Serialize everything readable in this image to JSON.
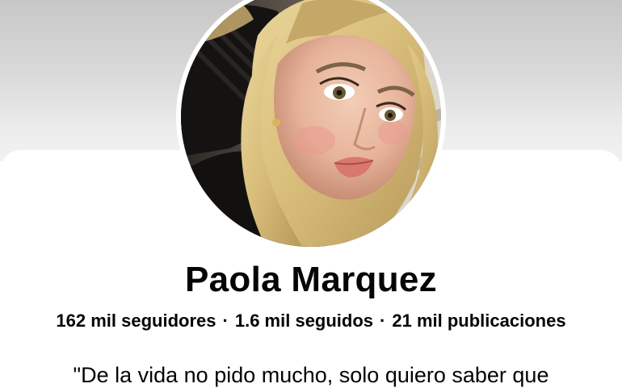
{
  "profile": {
    "name": "Paola Marquez",
    "stats": {
      "followers_count": "162 mil",
      "followers_label": "seguidores",
      "following_count": "1.6 mil",
      "following_label": "seguidos",
      "posts_count": "21 mil",
      "posts_label": "publicaciones",
      "separator": "·"
    },
    "bio": "\"De la vida no pido mucho, solo quiero saber que"
  },
  "colors": {
    "text": "#050505",
    "card_background": "#ffffff",
    "cover_gradient_top": "#c7c7c7"
  }
}
